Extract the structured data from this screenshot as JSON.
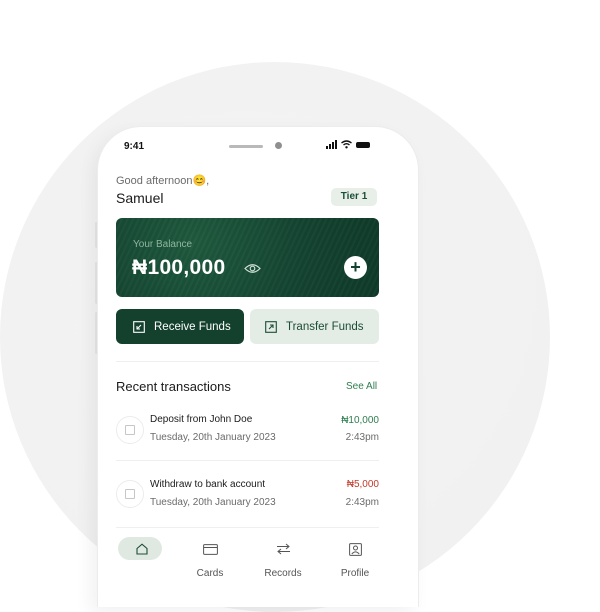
{
  "status_bar": {
    "time": "9:41"
  },
  "header": {
    "greeting": "Good afternoon😊,",
    "user_name": "Samuel",
    "tier_badge": "Tier 1"
  },
  "balance": {
    "label": "Your Balance",
    "amount": "₦100,000"
  },
  "actions": {
    "receive_label": "Receive Funds",
    "transfer_label": "Transfer Funds"
  },
  "transactions": {
    "title": "Recent transactions",
    "see_all": "See All",
    "items": [
      {
        "title": "Deposit from John Doe",
        "date": "Tuesday, 20th January 2023",
        "amount": "₦10,000",
        "time": "2:43pm",
        "type": "credit",
        "icon": "arrow-down-left-icon"
      },
      {
        "title": "Withdraw to bank account",
        "date": "Tuesday, 20th January 2023",
        "amount": "₦5,000",
        "time": "2:43pm",
        "type": "debit",
        "icon": "arrow-up-right-icon"
      }
    ]
  },
  "nav": {
    "items": [
      {
        "label": "",
        "icon": "home-icon",
        "active": true
      },
      {
        "label": "Cards",
        "icon": "card-icon"
      },
      {
        "label": "Records",
        "icon": "swap-icon"
      },
      {
        "label": "Profile",
        "icon": "profile-icon"
      }
    ]
  },
  "colors": {
    "brand_dark": "#14402e",
    "accent_light": "#e4ece6",
    "credit": "#2e7d4f",
    "debit": "#c0392b"
  }
}
